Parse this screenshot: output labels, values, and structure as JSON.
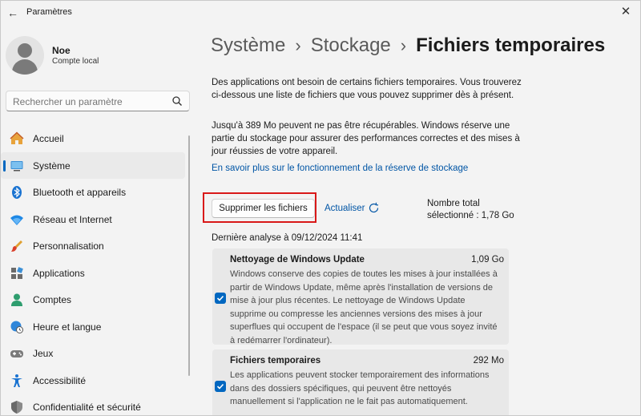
{
  "window": {
    "title": "Paramètres"
  },
  "profile": {
    "name": "Noe",
    "account_type": "Compte local"
  },
  "search": {
    "placeholder": "Rechercher un paramètre"
  },
  "sidebar": {
    "items": [
      {
        "label": "Accueil",
        "icon": "home-icon"
      },
      {
        "label": "Système",
        "icon": "system-icon",
        "active": true
      },
      {
        "label": "Bluetooth et appareils",
        "icon": "bluetooth-icon"
      },
      {
        "label": "Réseau et Internet",
        "icon": "wifi-icon"
      },
      {
        "label": "Personnalisation",
        "icon": "brush-icon"
      },
      {
        "label": "Applications",
        "icon": "apps-icon"
      },
      {
        "label": "Comptes",
        "icon": "accounts-icon"
      },
      {
        "label": "Heure et langue",
        "icon": "globe-clock-icon"
      },
      {
        "label": "Jeux",
        "icon": "gamepad-icon"
      },
      {
        "label": "Accessibilité",
        "icon": "accessibility-icon"
      },
      {
        "label": "Confidentialité et sécurité",
        "icon": "shield-icon"
      }
    ]
  },
  "breadcrumb": {
    "level1": "Système",
    "level2": "Stockage",
    "current": "Fichiers temporaires"
  },
  "main": {
    "intro": "Des applications ont besoin de certains fichiers temporaires. Vous trouverez ci-dessous une liste de fichiers que vous pouvez supprimer dès à présent.",
    "reserve_note": "Jusqu'à 389 Mo peuvent ne pas être récupérables. Windows réserve une partie du stockage pour assurer des performances correctes et des mises à jour réussies de votre appareil.",
    "reserve_link": "En savoir plus sur le fonctionnement de la réserve de stockage",
    "delete_button": "Supprimer les fichiers",
    "refresh_label": "Actualiser",
    "total_line1": "Nombre total",
    "total_line2": "sélectionné : 1,78 Go",
    "last_scan": "Dernière analyse à 09/12/2024 11:41",
    "items": [
      {
        "title": "Nettoyage de Windows Update",
        "size": "1,09 Go",
        "checked": true,
        "description": "Windows conserve des copies de toutes les mises à jour installées à partir de Windows Update, même après l'installation de versions de mise à jour plus récentes. Le nettoyage de Windows Update supprime ou compresse les anciennes versions des mises à jour superflues qui occupent de l'espace (il se peut que vous soyez invité à redémarrer l'ordinateur)."
      },
      {
        "title": "Fichiers temporaires",
        "size": "292 Mo",
        "checked": true,
        "description": "Les applications peuvent stocker temporairement des informations dans des dossiers spécifiques, qui peuvent être nettoyés manuellement si l'application ne le fait pas automatiquement."
      }
    ]
  },
  "colors": {
    "accent": "#0067c0",
    "highlight": "#d91919",
    "link": "#0055a5"
  }
}
